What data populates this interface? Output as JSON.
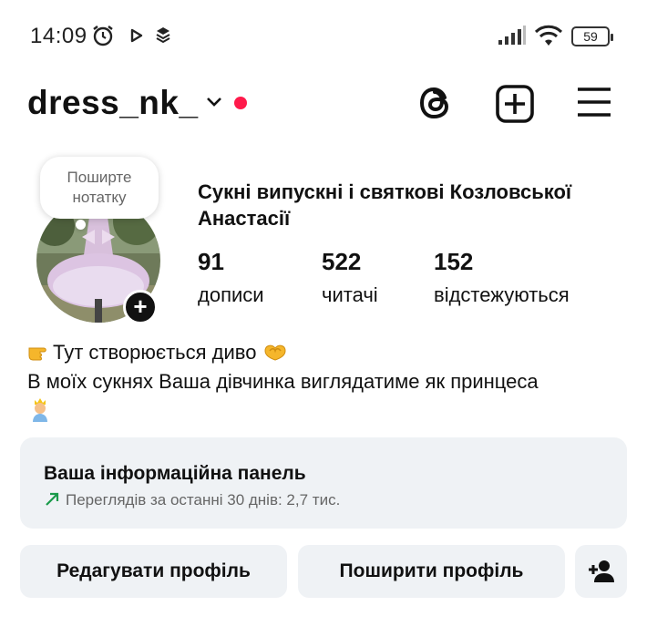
{
  "status_bar": {
    "time": "14:09",
    "battery": "59",
    "icons": [
      "alarm-icon",
      "play-icon",
      "layers-icon",
      "signal-icon",
      "wifi-icon",
      "battery-icon"
    ]
  },
  "header": {
    "username": "dress_nk_",
    "icons": [
      "chevron-down-icon",
      "threads-icon",
      "create-plus-icon",
      "menu-icon"
    ],
    "notification_dot_color": "#ff1a4b"
  },
  "profile": {
    "note_placeholder": "Поширте нотатку",
    "full_name": "Сукні випускні і святкові  Козловської Анастасії",
    "stats": [
      {
        "value": "91",
        "label": "дописи"
      },
      {
        "value": "522",
        "label": "читачі"
      },
      {
        "value": "152",
        "label": "відстежуються"
      }
    ],
    "bio_line1": "Тут створюється диво",
    "bio_line2": "В моїх сукнях Ваша дівчинка виглядатиме як принцеса"
  },
  "dashboard": {
    "title": "Ваша інформаційна панель",
    "subtitle": "Переглядів за останні 30 днів: 2,7 тис.",
    "trend_color": "#1a9a4a"
  },
  "actions": {
    "edit_profile": "Редагувати профіль",
    "share_profile": "Поширити профіль"
  }
}
